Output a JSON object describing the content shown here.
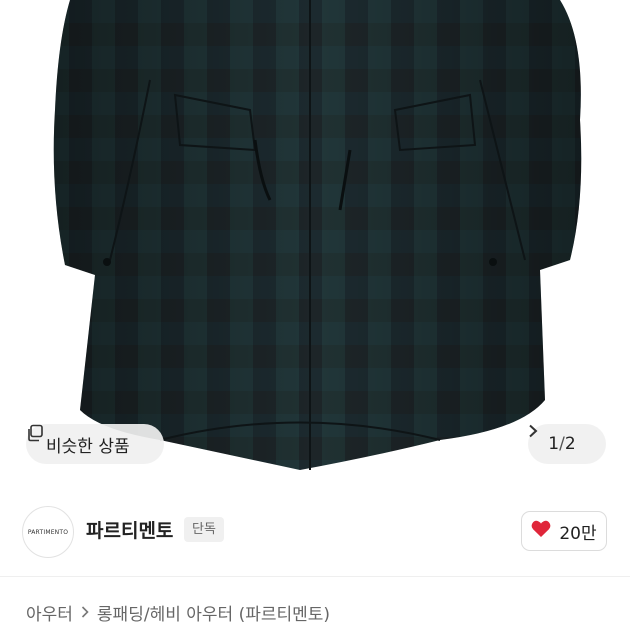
{
  "gallery": {
    "similar_label": "비슷한 상품",
    "page_current": "1",
    "page_total": "2",
    "page_separator": "/"
  },
  "shop": {
    "logo_text": "PARTIMENTO",
    "name": "파르티멘토",
    "badge": "단독",
    "likes": "20만"
  },
  "breadcrumb": {
    "items": [
      "아우터",
      "롱패딩/헤비 아우터 (파르티멘토)"
    ]
  },
  "colors": {
    "heart": "#e0263a",
    "jacket": "#1c2426"
  }
}
